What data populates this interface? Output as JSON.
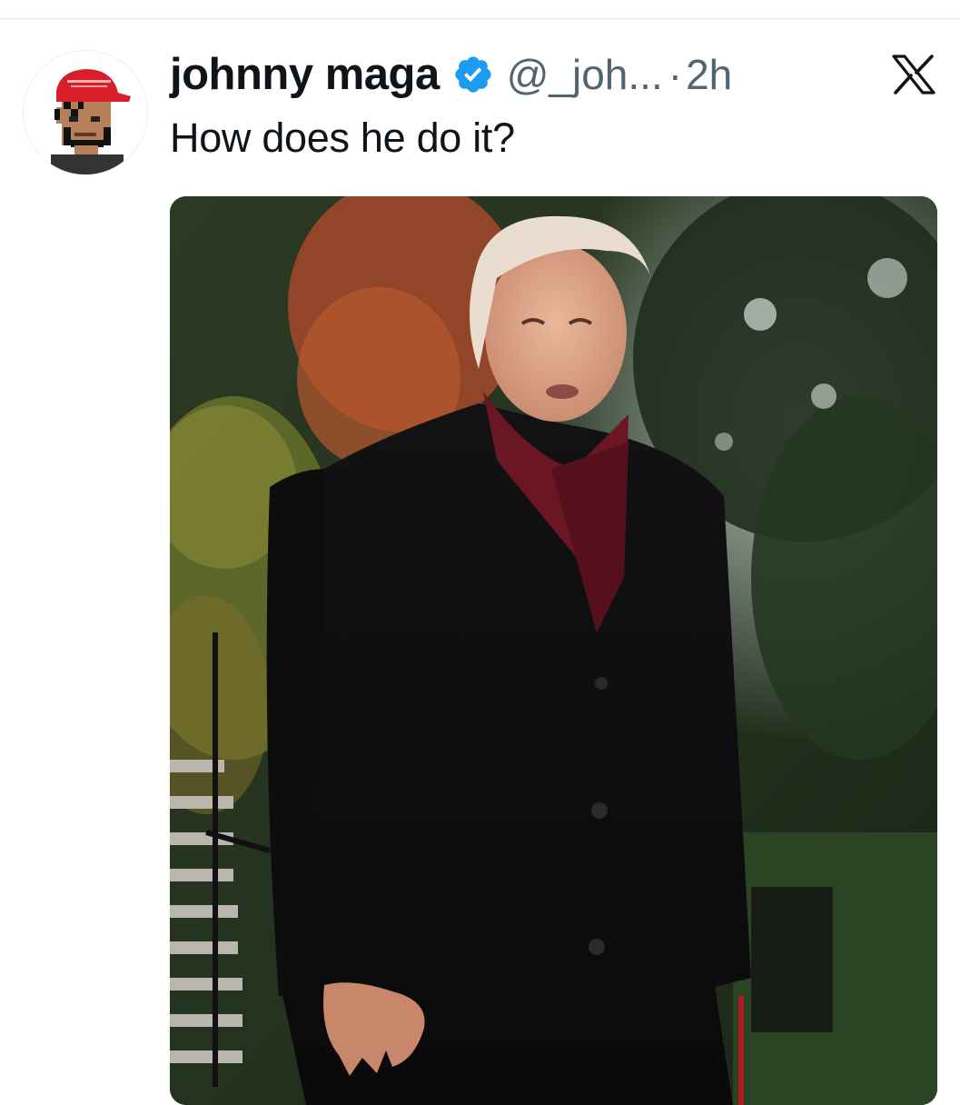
{
  "tweet": {
    "author": {
      "display_name": "johnny maga",
      "handle": "@_joh...",
      "verified": true,
      "avatar_icon": "pixel-maga-hat-avatar-icon"
    },
    "separator": "·",
    "timestamp": "2h",
    "text": "How does he do it?",
    "media": {
      "type": "photo",
      "icon": "photo-man-in-dark-coat-red-scarf"
    },
    "platform_icon": "x-logo-icon"
  },
  "colors": {
    "text_primary": "#0f1419",
    "text_secondary": "#536471",
    "verified_blue": "#1d9bf0",
    "divider": "#e6e6e6"
  }
}
